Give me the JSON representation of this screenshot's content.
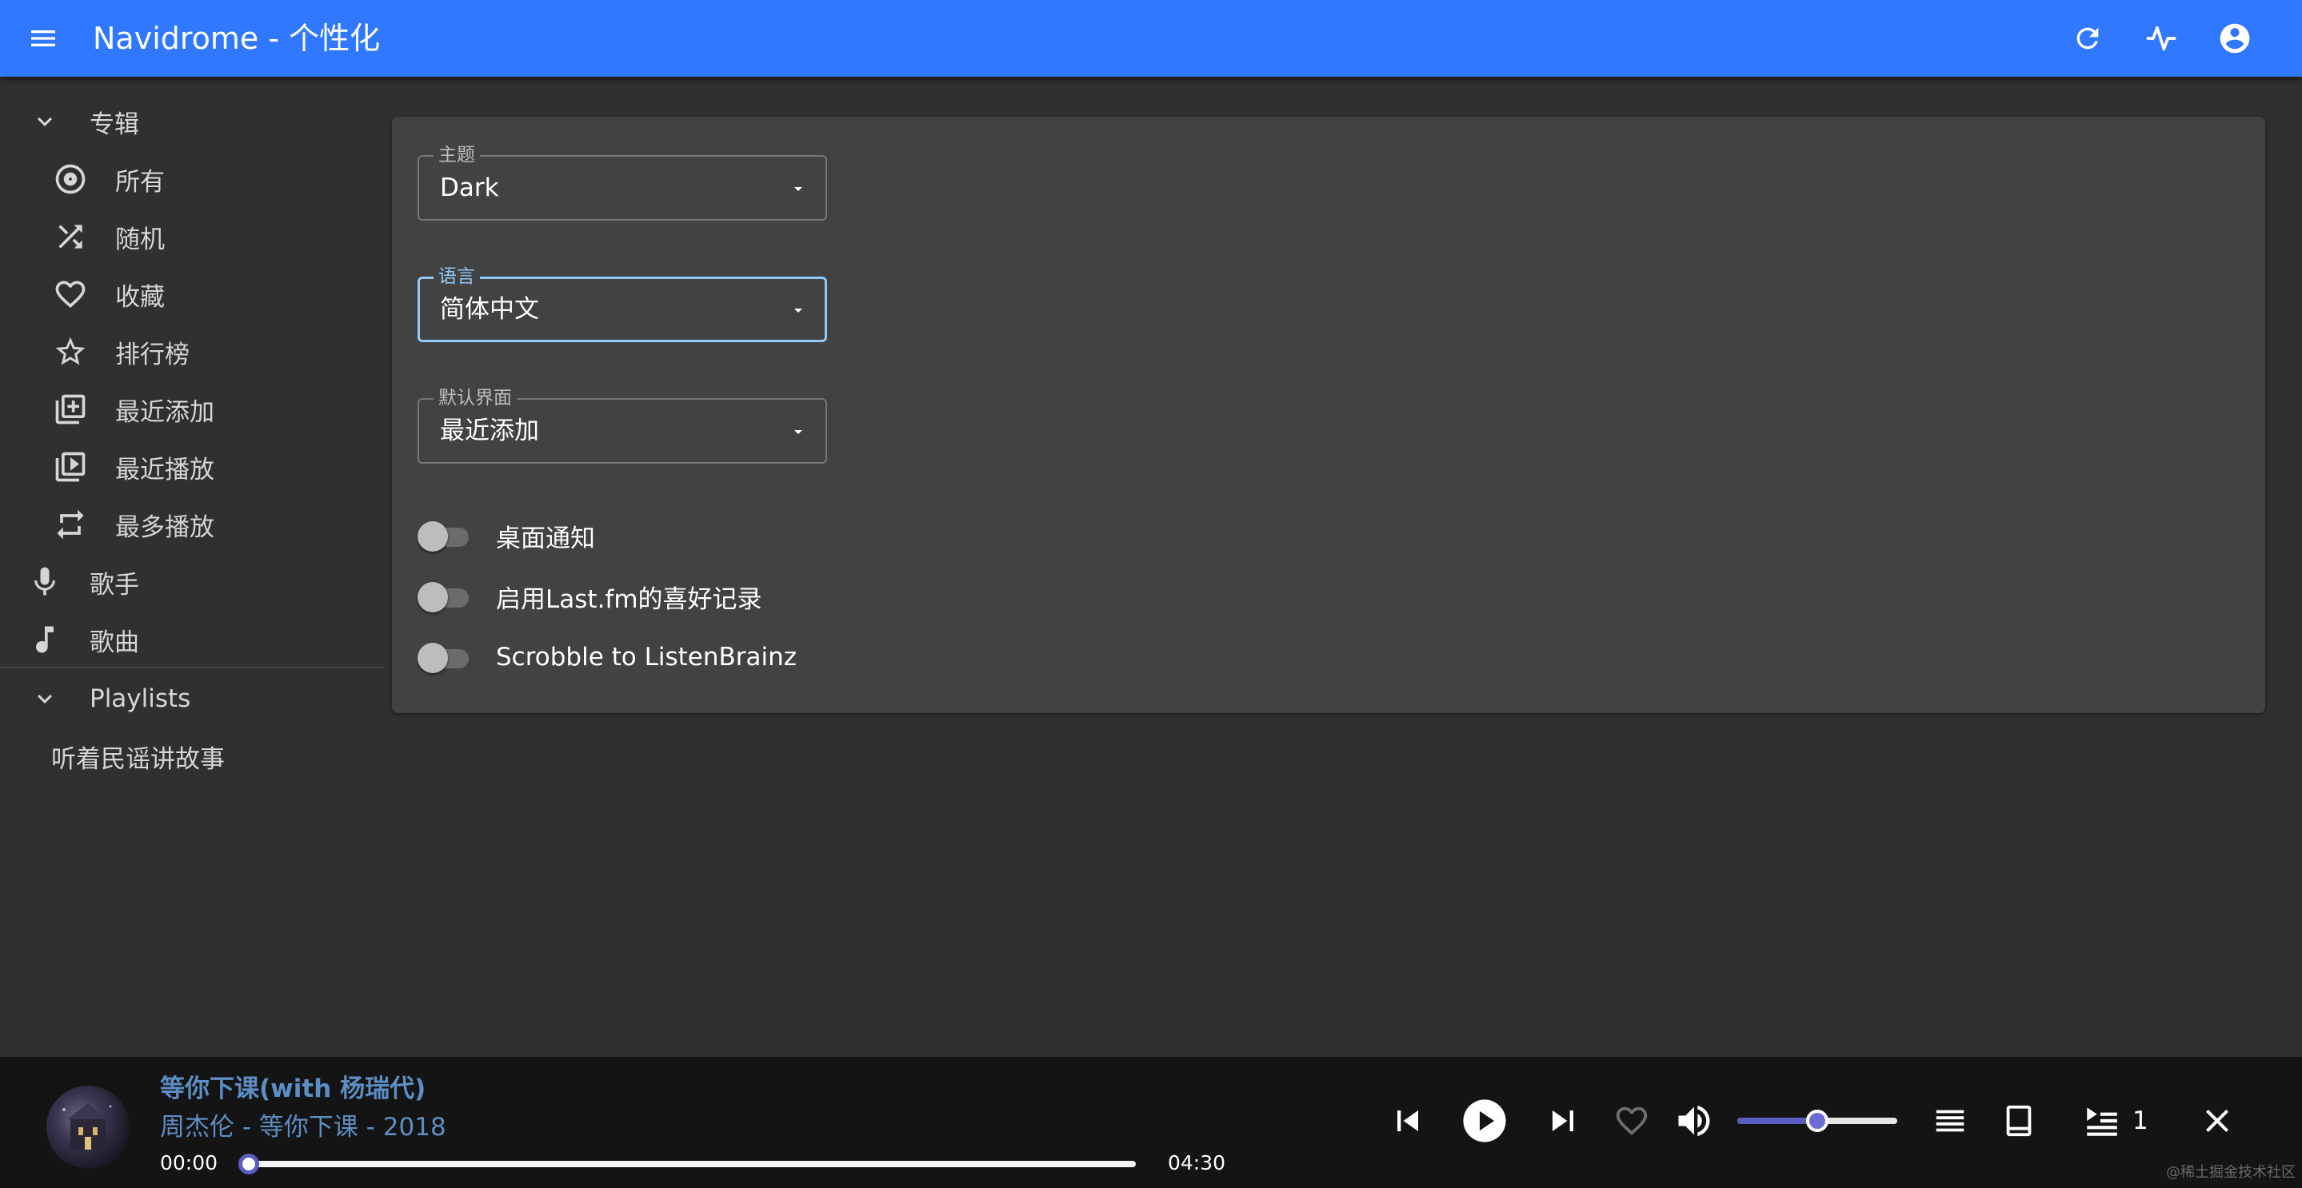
{
  "app": {
    "title": "Navidrome - 个性化"
  },
  "sidebar": {
    "albums_label": "专辑",
    "album_items": [
      {
        "label": "所有",
        "icon": "album-icon"
      },
      {
        "label": "随机",
        "icon": "shuffle-icon"
      },
      {
        "label": "收藏",
        "icon": "heart-icon"
      },
      {
        "label": "排行榜",
        "icon": "star-icon"
      },
      {
        "label": "最近添加",
        "icon": "library-add-icon"
      },
      {
        "label": "最近播放",
        "icon": "video-library-icon"
      },
      {
        "label": "最多播放",
        "icon": "repeat-icon"
      }
    ],
    "artists_label": "歌手",
    "songs_label": "歌曲",
    "playlists_label": "Playlists",
    "playlists": [
      "听着民谣讲故事"
    ]
  },
  "settings": {
    "theme": {
      "label": "主题",
      "value": "Dark"
    },
    "language": {
      "label": "语言",
      "value": "简体中文"
    },
    "default_view": {
      "label": "默认界面",
      "value": "最近添加"
    },
    "toggles": [
      {
        "label": "桌面通知",
        "on": false
      },
      {
        "label": "启用Last.fm的喜好记录",
        "on": false
      },
      {
        "label": "Scrobble to ListenBrainz",
        "on": false
      }
    ]
  },
  "player": {
    "title": "等你下课(with 杨瑞代)",
    "subtitle": "周杰伦 - 等你下课 - 2018",
    "current_time": "00:00",
    "total_time": "04:30",
    "progress": 0.0,
    "volume": 0.5,
    "queue_count": "1"
  },
  "watermark": "@稀土掘金技术社区",
  "colors": {
    "appbar": "#2f78ff",
    "accent": "#90caf9",
    "player_accent": "#5a5cc0"
  }
}
